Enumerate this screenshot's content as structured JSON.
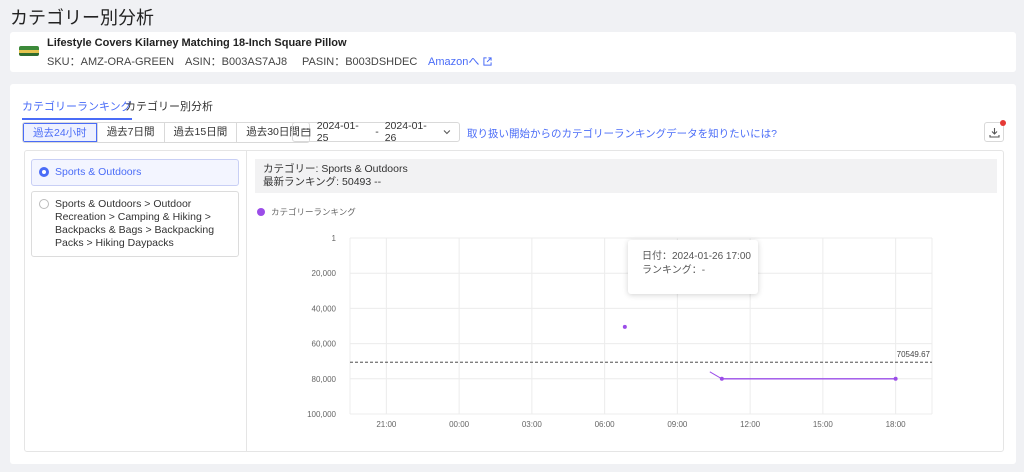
{
  "page": {
    "title": "カテゴリー別分析"
  },
  "product": {
    "name": "Lifestyle Covers Kilarney Matching 18-Inch Square Pillow",
    "sku": "SKU：AMZ-ORA-GREEN",
    "asin": "ASIN：B003AS7AJ8",
    "pasin": "PASIN：B003DSHDEC",
    "amazon_link": "Amazonへ"
  },
  "tabs": [
    {
      "label": "カテゴリーランキング",
      "active": true
    },
    {
      "label": "カテゴリー別分析",
      "active": false
    }
  ],
  "periods": [
    {
      "label": "過去24小时",
      "active": true
    },
    {
      "label": "過去7日間",
      "active": false
    },
    {
      "label": "過去15日間",
      "active": false
    },
    {
      "label": "過去30日間",
      "active": false
    }
  ],
  "date_range": {
    "start": "2024-01-25",
    "sep": "-",
    "end": "2024-01-26"
  },
  "question_link": "取り扱い開始からのカテゴリーランキングデータを知りたいには?",
  "categories": [
    {
      "label": "Sports & Outdoors",
      "selected": true
    },
    {
      "label": "Sports & Outdoors > Outdoor Recreation > Camping & Hiking > Backpacks & Bags > Backpacking Packs > Hiking Daypacks",
      "selected": false
    }
  ],
  "info": {
    "category_line": "カテゴリー: Sports & Outdoors",
    "ranking_line": "最新ランキング: 50493  --"
  },
  "tooltip": {
    "date_line": "日付：2024-01-26 17:00",
    "rank_line": "ランキング：-"
  },
  "colors": {
    "accent": "#4a6cf7",
    "series": "#9b4de8"
  },
  "chart_data": {
    "type": "line",
    "series": [
      {
        "name": "カテゴリーランキング",
        "points": [
          {
            "x": "06:50",
            "y": 50493
          },
          {
            "x": "10:50",
            "y": 80000
          },
          {
            "x": "18:00",
            "y": 80000
          }
        ]
      }
    ],
    "x_ticks": [
      "21:00",
      "00:00",
      "03:00",
      "06:00",
      "09:00",
      "12:00",
      "15:00",
      "18:00"
    ],
    "y_ticks": [
      "1",
      "20,000",
      "40,000",
      "60,000",
      "80,000",
      "100,000"
    ],
    "y_tick_values": [
      1,
      20000,
      40000,
      60000,
      80000,
      100000
    ],
    "ylim": [
      1,
      100000
    ],
    "y_inverted": true,
    "reference_line": {
      "value": 70549.67,
      "label": "70549.67"
    },
    "grid": true
  }
}
